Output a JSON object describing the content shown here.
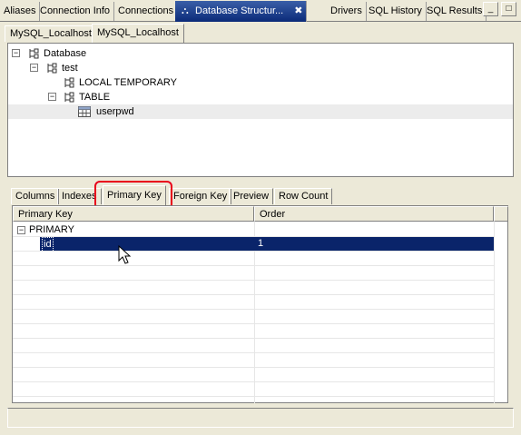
{
  "top_tabs": [
    "Aliases",
    "Connection Info",
    "Connections",
    "Database Structur...",
    "Drivers",
    "SQL History",
    "SQL Results"
  ],
  "close_glyph": "✖",
  "window_controls": {
    "minimize": "_",
    "maximize": "□"
  },
  "connection_tabs": [
    "MySQL_Localhost",
    "MySQL_Localhost"
  ],
  "tree": {
    "database": "Database",
    "schema": "test",
    "local_temporary": "LOCAL TEMPORARY",
    "table": "TABLE",
    "table_item": "userpwd"
  },
  "detail_tabs": [
    "Columns",
    "Indexes",
    "Primary Key",
    "Foreign Key",
    "Preview",
    "Row Count"
  ],
  "grid": {
    "headers": [
      "Primary Key",
      "Order"
    ],
    "group": "PRIMARY",
    "row": {
      "key": "id",
      "order": "1"
    }
  },
  "colors": {
    "accent": "#0a246a",
    "selection": "#0a246a",
    "highlight_box": "#e8001c"
  }
}
